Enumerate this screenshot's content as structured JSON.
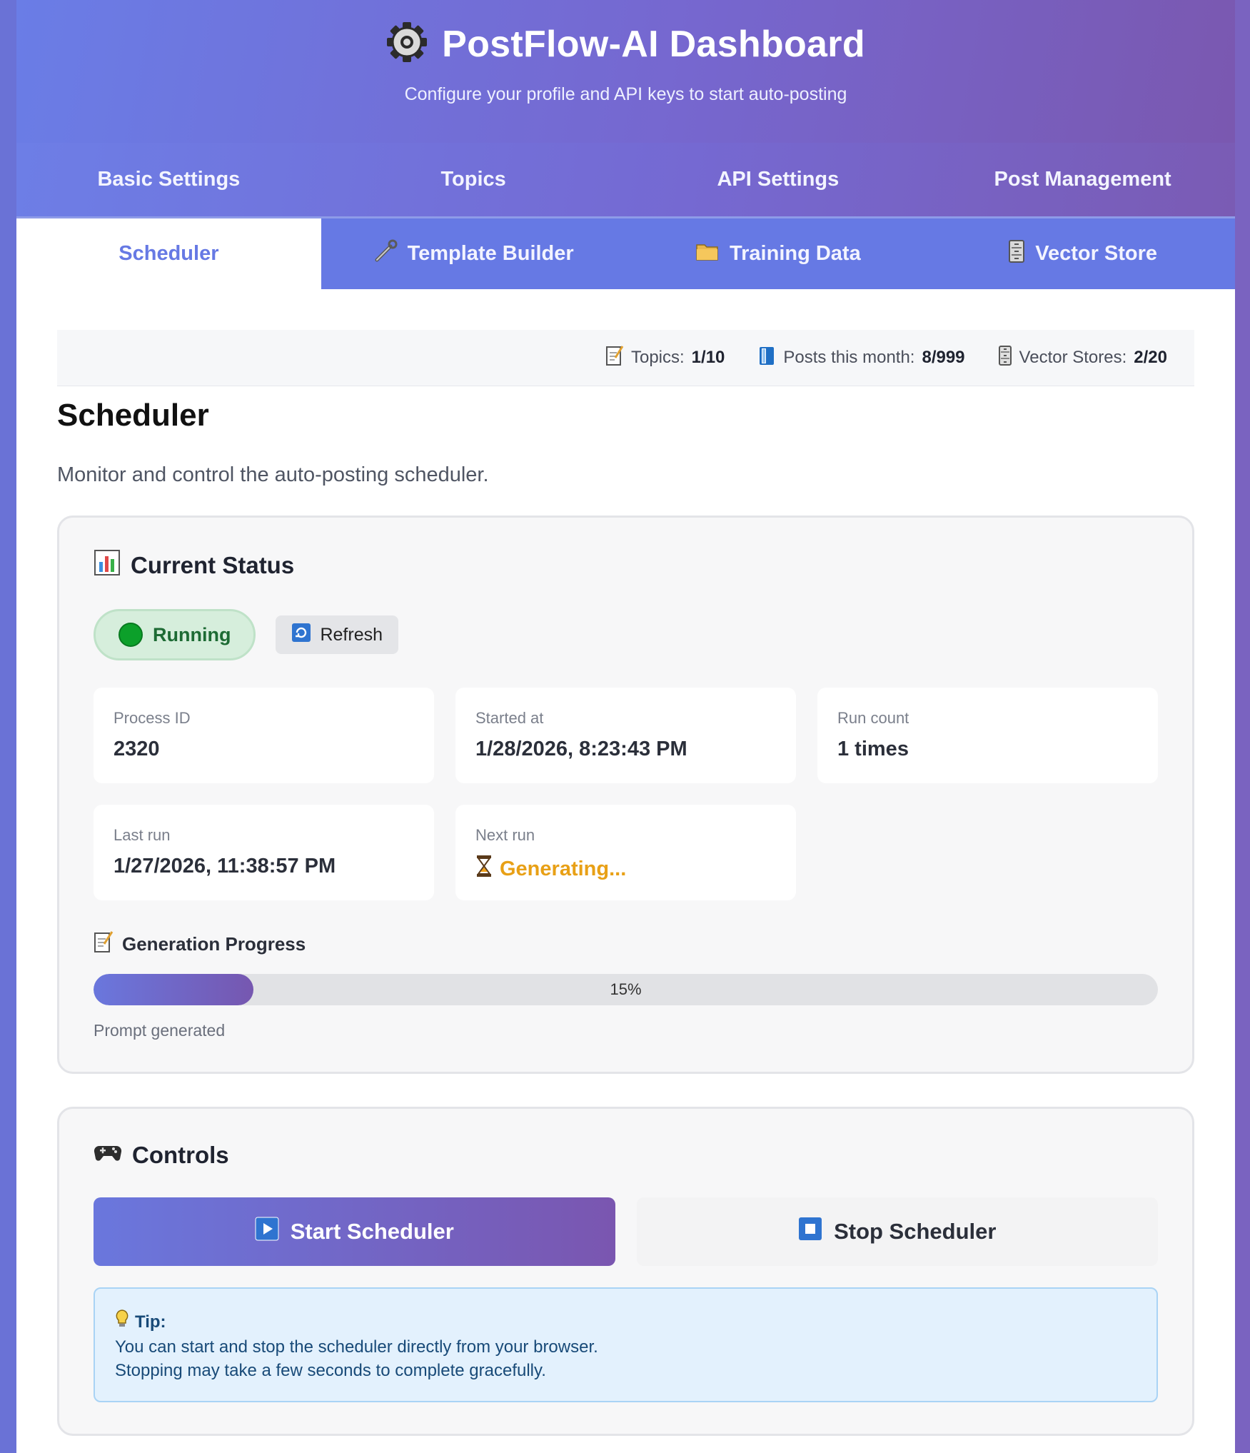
{
  "header": {
    "title": "PostFlow-AI Dashboard",
    "subtitle": "Configure your profile and API keys to start auto-posting",
    "icon": "gear-icon"
  },
  "tabs_primary": [
    {
      "label": "Basic Settings"
    },
    {
      "label": "Topics"
    },
    {
      "label": "API Settings"
    },
    {
      "label": "Post Management"
    }
  ],
  "tabs_secondary": [
    {
      "label": "Scheduler",
      "active": true
    },
    {
      "label": "Template Builder",
      "icon": "wrench-icon"
    },
    {
      "label": "Training Data",
      "icon": "folder-icon"
    },
    {
      "label": "Vector Store",
      "icon": "cabinet-icon"
    }
  ],
  "usage": {
    "topics_label": "Topics:",
    "topics_value": "1/10",
    "posts_label": "Posts this month:",
    "posts_value": "8/999",
    "vector_label": "Vector Stores:",
    "vector_value": "2/20"
  },
  "page": {
    "title": "Scheduler",
    "description": "Monitor and control the auto-posting scheduler."
  },
  "status": {
    "heading": "Current Status",
    "state": "Running",
    "refresh_label": "Refresh",
    "process_id_label": "Process ID",
    "process_id": "2320",
    "started_label": "Started at",
    "started": "1/28/2026, 8:23:43 PM",
    "run_count_label": "Run count",
    "run_count": "1 times",
    "last_run_label": "Last run",
    "last_run": "1/27/2026, 11:38:57 PM",
    "next_run_label": "Next run",
    "next_run": "Generating..."
  },
  "progress": {
    "heading": "Generation Progress",
    "percent": 15,
    "percent_text": "15%",
    "note": "Prompt generated"
  },
  "controls": {
    "heading": "Controls",
    "start_label": "Start Scheduler",
    "stop_label": "Stop Scheduler",
    "tip_title": "Tip:",
    "tip_line1": "You can start and stop the scheduler directly from your browser.",
    "tip_line2": "Stopping may take a few seconds to complete gracefully."
  },
  "colors": {
    "accent": "#6679e4",
    "running_green": "#0ca02a",
    "generating_orange": "#e8a016"
  }
}
